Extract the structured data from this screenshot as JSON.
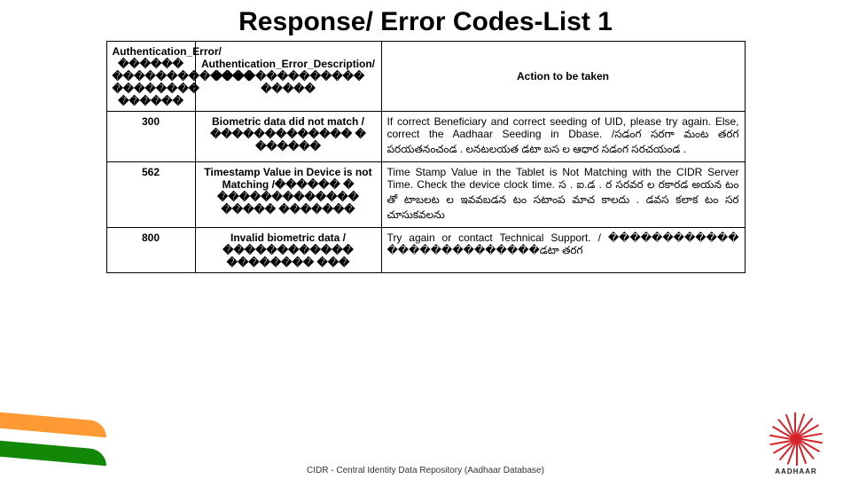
{
  "title": "Response/ Error Codes-List 1",
  "header": {
    "col1": "Authentication_Error/ ������ ������������� �������� ������",
    "col2": "Authentication_Error_Description/ �������������� �����",
    "col3": "Action to be taken"
  },
  "rows": [
    {
      "code": "300",
      "desc": "Biometric data did not match / ������������� � ������",
      "action": "If correct Beneficiary and correct seeding of UID, please try again. Else, correct the Aadhaar Seeding in Dbase. /సడంగ సరగా మంట తరగ పరయతనంచండ . లనటలయత డటా బస ల ఆధార సడంగ సరచయండ ."
    },
    {
      "code": "562",
      "desc": "Timestamp Value in Device is not Matching /������ � ������������� ����� �������",
      "action": "Time Stamp Value in the Tablet is Not Matching with the CIDR Server Time. Check the device clock time. స . ఐ.డ . ర సరవర ల రకారడ అయన టం తో టాబలట ల ఇవవబడన టం సటాంప మాచ కాలదు . డవస కలాక టం సర చూసుకవలను"
    },
    {
      "code": "800",
      "desc": "Invalid biometric data /������������ �������� ���",
      "action": "Try again or contact Technical Support. / ������������ ��������������డటా తరగ"
    }
  ],
  "footer": "CIDR - Central Identity Data Repository (Aadhaar Database)",
  "logo_text": "AADHAAR"
}
